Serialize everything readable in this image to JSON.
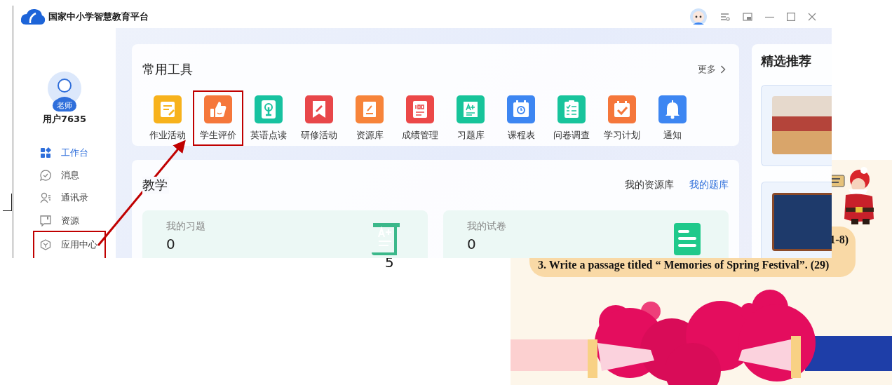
{
  "window": {
    "title": "国家中小学智慧教育平台"
  },
  "sidebar": {
    "badge": "老师",
    "user_name": "用户7635",
    "items": [
      {
        "label": "工作台",
        "kind": "grid",
        "selected": true
      },
      {
        "label": "消息",
        "kind": "chat",
        "selected": false
      },
      {
        "label": "通讯录",
        "kind": "contacts",
        "selected": false
      },
      {
        "label": "资源",
        "kind": "book",
        "selected": false
      },
      {
        "label": "应用中心",
        "kind": "hexagon",
        "selected": false,
        "highlighted": true
      }
    ]
  },
  "tools": {
    "title": "常用工具",
    "more": "更多",
    "items": [
      {
        "label": "作业活动",
        "kind": "note",
        "color": "#f7b21c",
        "highlighted": false
      },
      {
        "label": "学生评价",
        "kind": "thumb",
        "color": "#f5773b",
        "highlighted": true
      },
      {
        "label": "英语点读",
        "kind": "touch",
        "color": "#17c2a0",
        "highlighted": false
      },
      {
        "label": "研修活动",
        "kind": "bookmark",
        "color": "#e8474a",
        "highlighted": false
      },
      {
        "label": "资源库",
        "kind": "edit",
        "color": "#f7843a",
        "highlighted": false
      },
      {
        "label": "成绩管理",
        "kind": "score",
        "color": "#ec4848",
        "highlighted": false
      },
      {
        "label": "习题库",
        "kind": "grade",
        "color": "#17c49a",
        "highlighted": false
      },
      {
        "label": "课程表",
        "kind": "clock",
        "color": "#3d86f2",
        "highlighted": false
      },
      {
        "label": "问卷调查",
        "kind": "checklist",
        "color": "#18c49c",
        "highlighted": false
      },
      {
        "label": "学习计划",
        "kind": "calendar",
        "color": "#f5773b",
        "highlighted": false
      },
      {
        "label": "通知",
        "kind": "bell",
        "color": "#3d86f2",
        "highlighted": false
      }
    ]
  },
  "teaching": {
    "title": "教学",
    "links": [
      {
        "label": "我的资源库",
        "selected": false
      },
      {
        "label": "我的题库",
        "selected": true
      }
    ],
    "cards": [
      {
        "label": "我的习题",
        "value": "0",
        "kind": "scroll"
      },
      {
        "label": "我的试卷",
        "value": "0",
        "kind": "doc"
      }
    ]
  },
  "featured": {
    "title": "精选推荐"
  },
  "page_number": "5",
  "slide": {
    "lines": [
      "1-8)",
      "3. Write a passage titled “ Memories of Spring Festival”. (29)"
    ]
  }
}
